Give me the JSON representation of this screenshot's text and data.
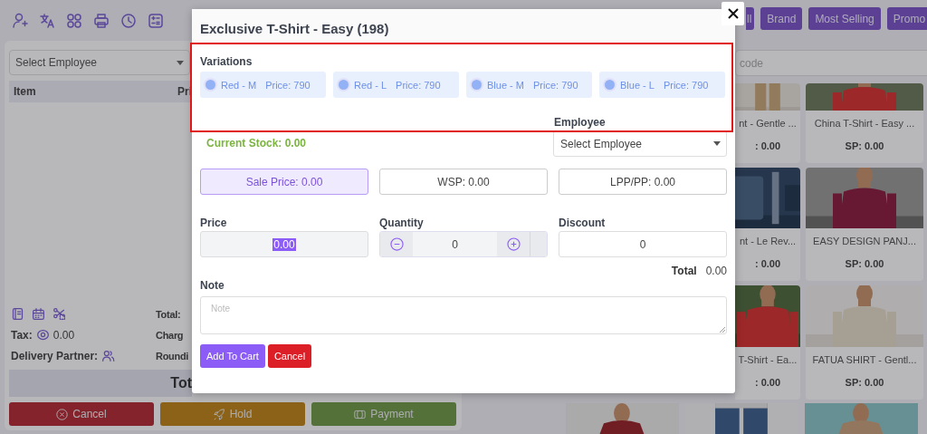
{
  "left": {
    "employee_select": {
      "placeholder": "Select Employee"
    },
    "columns": [
      "Item",
      "Pri"
    ],
    "tax_label": "Tax:",
    "tax_value": "0.00",
    "delivery_label": "Delivery Partner:",
    "summary": [
      "Total:",
      "Charg",
      "Roundi"
    ],
    "total_bar": "Tot",
    "actions": [
      {
        "label": "Cancel",
        "kind": "cancel"
      },
      {
        "label": "Hold",
        "kind": "hold"
      },
      {
        "label": "Payment",
        "kind": "payment"
      }
    ]
  },
  "right": {
    "filters": [
      "ll",
      "Brand",
      "Most Selling",
      "Promo"
    ],
    "search": {
      "placeholder": "code"
    },
    "products": [
      {
        "name": "nt - Gentle ...",
        "price": ": 0.00"
      },
      {
        "name": "China T-Shirt - Easy ...",
        "price": "SP: 0.00"
      },
      {
        "name": "nt - Le Rev...",
        "price": ": 0.00"
      },
      {
        "name": "EASY DESIGN PANJ...",
        "price": "SP: 0.00"
      },
      {
        "name": "T-Shirt - Ea...",
        "price": ": 0.00"
      },
      {
        "name": "FATUA SHIRT - Gentl...",
        "price": "SP: 0.00"
      }
    ]
  },
  "modal": {
    "title": "Exclusive T-Shirt - Easy (198)",
    "variations_label": "Variations",
    "variations": [
      {
        "name": "Red - M",
        "price": "Price: 790",
        "selected": false
      },
      {
        "name": "Red - L",
        "price": "Price: 790",
        "selected": false
      },
      {
        "name": "Blue - M",
        "price": "Price: 790",
        "selected": false
      },
      {
        "name": "Blue - L",
        "price": "Price: 790",
        "selected": false
      }
    ],
    "employee_label": "Employee",
    "employee_select": {
      "placeholder": "Select Employee"
    },
    "stock": "Current Stock: 0.00",
    "price_types": [
      {
        "label": "Sale Price: 0.00",
        "selected": true
      },
      {
        "label": "WSP: 0.00",
        "selected": false
      },
      {
        "label": "LPP/PP: 0.00",
        "selected": false
      }
    ],
    "price_label": "Price",
    "price_value": "0.00",
    "quantity_label": "Quantity",
    "quantity_value": "0",
    "discount_label": "Discount",
    "discount_value": "0",
    "total_label": "Total",
    "total_value": "0.00",
    "note_label": "Note",
    "note": {
      "placeholder": "Note"
    },
    "buttons": [
      {
        "label": "Add To Cart",
        "kind": "primary"
      },
      {
        "label": "Cancel",
        "kind": "danger"
      }
    ]
  }
}
